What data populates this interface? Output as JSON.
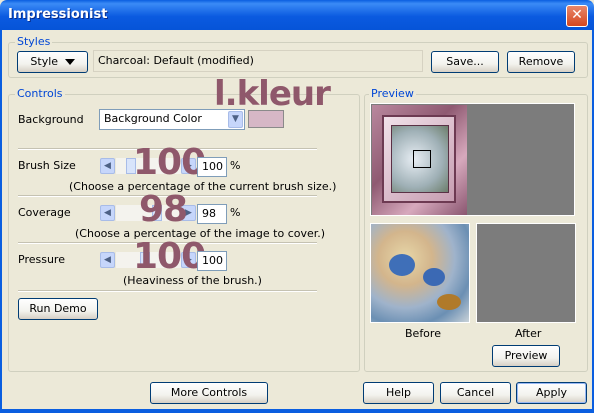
{
  "window": {
    "title": "Impressionist",
    "close_glyph": "✕"
  },
  "styles": {
    "legend": "Styles",
    "style_button": "Style",
    "preset_name": "Charcoal: Default (modified)",
    "save_label": "Save...",
    "remove_label": "Remove"
  },
  "watermark": "l.kleur",
  "controls": {
    "legend": "Controls",
    "background_label": "Background",
    "background_value": "Background Color",
    "background_swatch_color": "#d6b7c6",
    "brush_size": {
      "label": "Brush Size",
      "value": "100",
      "overlay": "100",
      "unit": "%",
      "hint": "(Choose a percentage of the current brush size.)"
    },
    "coverage": {
      "label": "Coverage",
      "value": "98",
      "overlay": "98",
      "unit": "%",
      "hint": "(Choose a percentage of the image to cover.)"
    },
    "pressure": {
      "label": "Pressure",
      "value": "100",
      "overlay": "100",
      "hint": "(Heaviness of the brush.)"
    },
    "run_demo_label": "Run Demo"
  },
  "preview": {
    "legend": "Preview",
    "before_label": "Before",
    "after_label": "After",
    "preview_button": "Preview"
  },
  "footer": {
    "more_controls_label": "More Controls",
    "help_label": "Help",
    "cancel_label": "Cancel",
    "apply_label": "Apply"
  }
}
